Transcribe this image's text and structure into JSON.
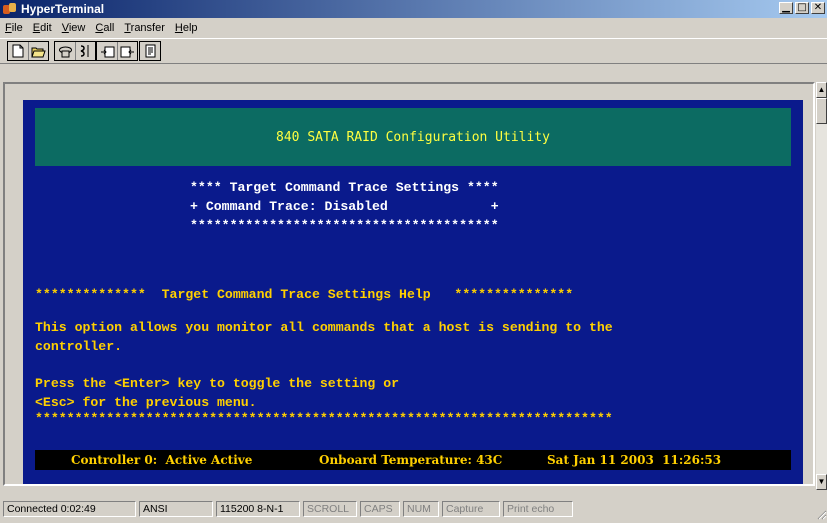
{
  "window": {
    "title": "HyperTerminal",
    "controls": {
      "minimize": "▁",
      "maximize": "□",
      "close": "✕"
    }
  },
  "menubar": {
    "items": [
      {
        "label": "File",
        "key": "F"
      },
      {
        "label": "Edit",
        "key": "E"
      },
      {
        "label": "View",
        "key": "V"
      },
      {
        "label": "Call",
        "key": "C"
      },
      {
        "label": "Transfer",
        "key": "T"
      },
      {
        "label": "Help",
        "key": "H"
      }
    ]
  },
  "toolbar": {
    "icons": [
      "new-icon",
      "open-icon",
      "connect-icon",
      "disconnect-icon",
      "send-icon",
      "receive-icon",
      "properties-icon"
    ]
  },
  "terminal": {
    "banner": "840 SATA RAID Configuration Utility",
    "settings_lines": [
      "**** Target Command Trace Settings ****",
      "+ Command Trace: Disabled             +",
      "***************************************"
    ],
    "help_header": "**************  Target Command Trace Settings Help   ***************",
    "help_lines": [
      "This option allows you monitor all commands that a host is sending to the",
      "controller.",
      "",
      "Press the <Enter> key to toggle the setting or",
      "<Esc> for the previous menu.",
      "*************************************************************************"
    ],
    "footer": {
      "controller": "Controller 0:  Active Active",
      "temperature": "Onboard Temperature: 43C",
      "datetime": "Sat Jan 11 2003  11:26:53"
    },
    "colors": {
      "background": "#0a1a8c",
      "banner": "#0c6b62",
      "accent": "#ffd000"
    }
  },
  "statusbar": {
    "cells": [
      {
        "label": "Connected 0:02:49",
        "enabled": true
      },
      {
        "label": "ANSI",
        "enabled": true
      },
      {
        "label": "115200 8-N-1",
        "enabled": true
      },
      {
        "label": "SCROLL",
        "enabled": false
      },
      {
        "label": "CAPS",
        "enabled": false
      },
      {
        "label": "NUM",
        "enabled": false
      },
      {
        "label": "Capture",
        "enabled": false
      },
      {
        "label": "Print echo",
        "enabled": false
      }
    ]
  }
}
